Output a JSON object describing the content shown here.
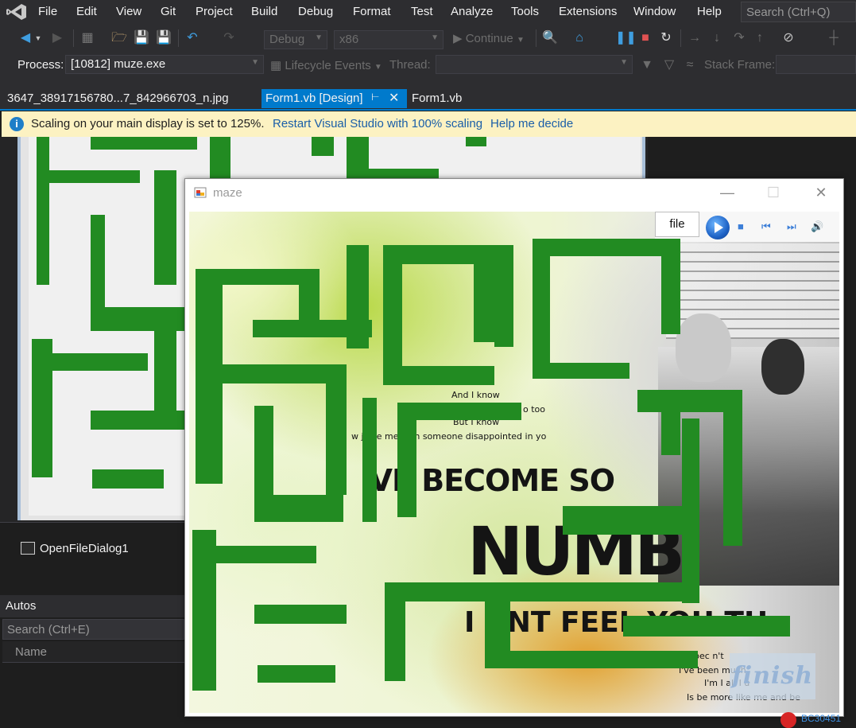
{
  "menu": [
    "File",
    "Edit",
    "View",
    "Git",
    "Project",
    "Build",
    "Debug",
    "Format",
    "Test",
    "Analyze",
    "Tools",
    "Extensions",
    "Window",
    "Help"
  ],
  "search": {
    "placeholder": "Search (Ctrl+Q)"
  },
  "toolbar": {
    "config": "Debug",
    "platform": "x86",
    "continue_label": "Continue",
    "process_label": "Process:",
    "process_value": "[10812] muze.exe",
    "lifecycle_label": "Lifecycle Events",
    "thread_label": "Thread:",
    "stack_label": "Stack Frame:"
  },
  "tabs": [
    {
      "label": "3647_38917156780...7_842966703_n.jpg"
    },
    {
      "label": "Form1.vb [Design]"
    },
    {
      "label": "Form1.vb"
    }
  ],
  "infobar": {
    "message": "Scaling on your main display is set to 125%.",
    "restart_link": "Restart Visual Studio with 100% scaling",
    "help_link": "Help me decide"
  },
  "tray": {
    "component": "OpenFileDialog1"
  },
  "autos": {
    "title": "Autos",
    "search_placeholder": "Search (Ctrl+E)",
    "column_name": "Name"
  },
  "form_window": {
    "title": "maze",
    "file_button": "file",
    "finish_label": "finish"
  },
  "artwork_text": {
    "line1": "And I know",
    "line2": "o too",
    "line3": "But I know",
    "line4": "w    jus       e me with someone disappointed in yo",
    "line5": "'VE BECOME SO",
    "line6": "NUMB",
    "line7": "I   ANT FEEL YOU TH",
    "line8": "I've bec          n't",
    "line9": "I've been            much",
    "line10": "I'm I        all I u",
    "line11": "Is be more like me and be"
  },
  "status": {
    "error_code": "BC30451"
  },
  "colors": {
    "wall": "#228b22",
    "accent": "#007acc",
    "info_bg": "#fcf2c2"
  }
}
